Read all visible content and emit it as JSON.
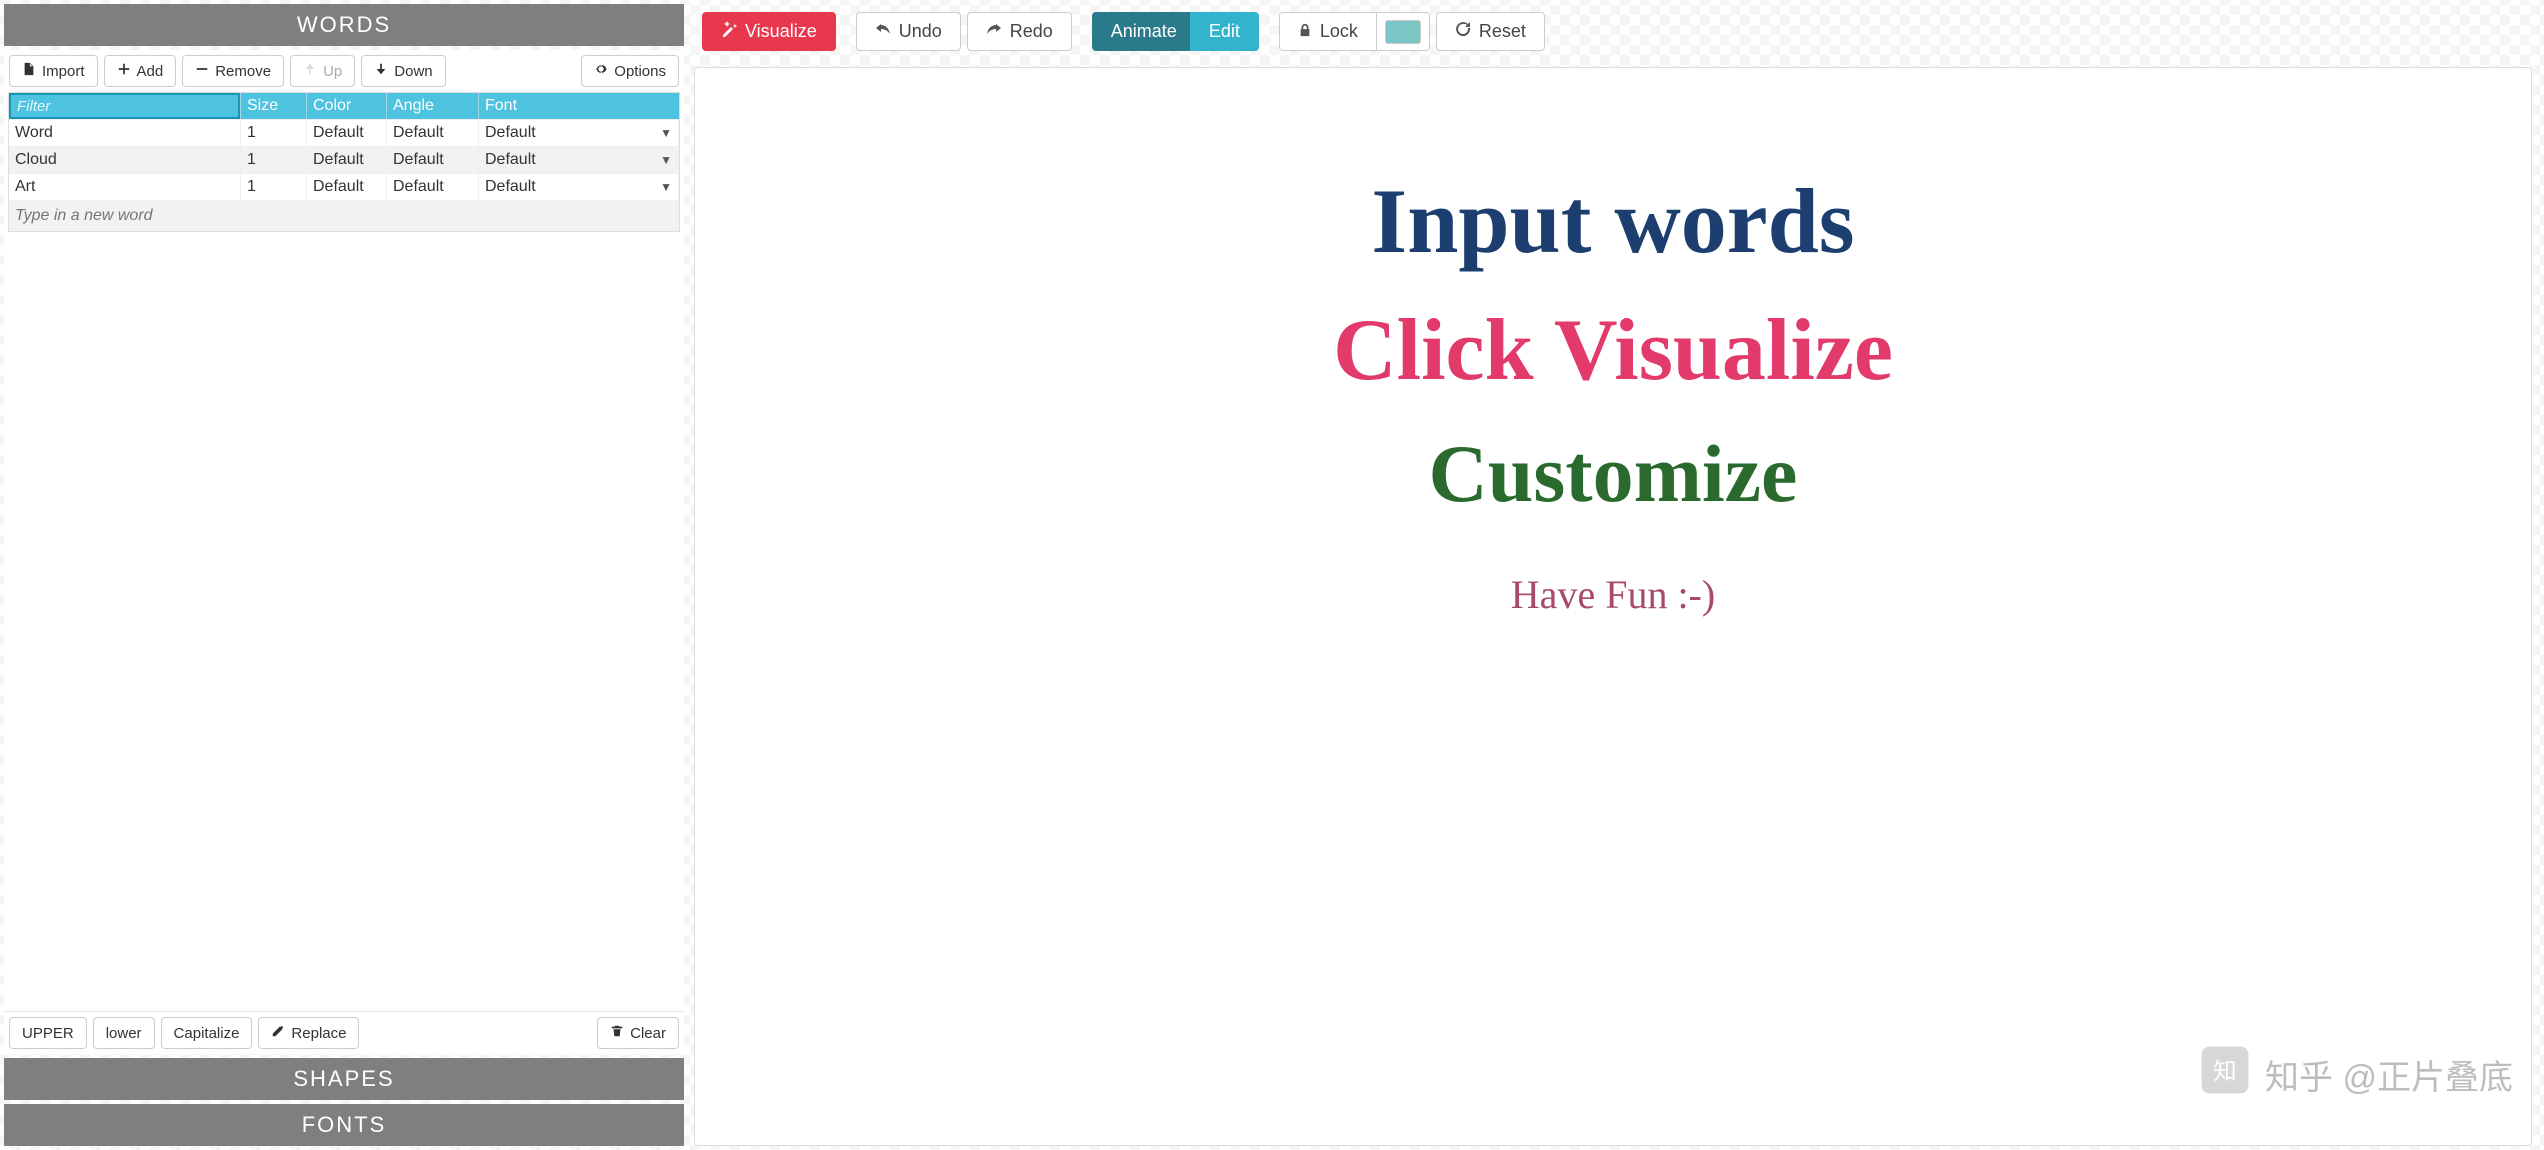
{
  "left": {
    "words_header": "WORDS",
    "shapes_header": "SHAPES",
    "fonts_header": "FONTS",
    "toolbar": {
      "import": "Import",
      "add": "Add",
      "remove": "Remove",
      "up": "Up",
      "down": "Down",
      "options": "Options"
    },
    "table": {
      "filter_placeholder": "Filter",
      "cols": {
        "size": "Size",
        "color": "Color",
        "angle": "Angle",
        "font": "Font"
      },
      "rows": [
        {
          "word": "Word",
          "size": "1",
          "color": "Default",
          "angle": "Default",
          "font": "Default"
        },
        {
          "word": "Cloud",
          "size": "1",
          "color": "Default",
          "angle": "Default",
          "font": "Default"
        },
        {
          "word": "Art",
          "size": "1",
          "color": "Default",
          "angle": "Default",
          "font": "Default"
        }
      ],
      "new_placeholder": "Type in a new word"
    },
    "footer": {
      "upper": "UPPER",
      "lower": "lower",
      "capitalize": "Capitalize",
      "replace": "Replace",
      "clear": "Clear"
    }
  },
  "right": {
    "toolbar": {
      "visualize": "Visualize",
      "undo": "Undo",
      "redo": "Redo",
      "animate": "Animate",
      "edit": "Edit",
      "lock": "Lock",
      "reset": "Reset",
      "swatch_color": "#7bc5c5"
    },
    "canvas": {
      "line1": "Input words",
      "line2": "Click Visualize",
      "line3": "Customize",
      "line4": "Have Fun :-)"
    },
    "watermark": "知乎 @正片叠底"
  }
}
